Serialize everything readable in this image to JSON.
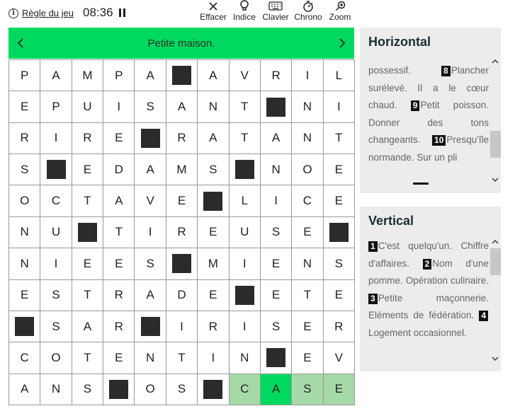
{
  "header": {
    "rules_label": "Règle du jeu",
    "time": "08:36"
  },
  "toolbar": [
    {
      "name": "erase",
      "label": "Effacer",
      "icon": "close-icon"
    },
    {
      "name": "hint",
      "label": "Indice",
      "icon": "lightbulb-icon"
    },
    {
      "name": "keyboard",
      "label": "Clavier",
      "icon": "keyboard-icon"
    },
    {
      "name": "timer",
      "label": "Chrono",
      "icon": "stopwatch-icon"
    },
    {
      "name": "zoom",
      "label": "Zoom",
      "icon": "zoom-icon"
    }
  ],
  "banner": {
    "clue": "Petite maison."
  },
  "grid": {
    "rows": [
      "PAMPA#AVRIL",
      "EPUISANT#NI",
      "RIRE#RATANT",
      "S#EDAMS#NOE",
      "OCTAVE#LICE",
      "NU#TIREUSE#",
      "NIEES#MIENS",
      "ESTRADE#ETE",
      "#SAR#IRISER",
      "COTENTIN#EV",
      "ANS#OS#CASE"
    ],
    "selected_row": 10,
    "selected_cols": [
      7,
      8,
      9,
      10
    ],
    "current_col": 8
  },
  "horizontal": {
    "title": "Horizontal",
    "clues": [
      {
        "num": "",
        "text": "possessif."
      },
      {
        "num": "8",
        "text": "Plancher surélevé. Il a le cœur chaud."
      },
      {
        "num": "9",
        "text": "Petit poisson. Donner des tons changeants."
      },
      {
        "num": "10",
        "text": "Presqu'île normande. Sur un pli"
      }
    ]
  },
  "vertical": {
    "title": "Vertical",
    "clues": [
      {
        "num": "1",
        "text": "C'est quelqu'un. Chiffre d'affaires."
      },
      {
        "num": "2",
        "text": "Nom d'une pomme. Opération culinaire."
      },
      {
        "num": "3",
        "text": "Petite maçonnerie. Eléments de fédération."
      },
      {
        "num": "4",
        "text": "Logement occasionnel."
      }
    ]
  },
  "colors": {
    "banner": "#00d95f",
    "current_cell": "#00d95f",
    "word_cell": "#a6d9a8",
    "black_cell": "#2b2b2b",
    "panel": "#ececec"
  }
}
